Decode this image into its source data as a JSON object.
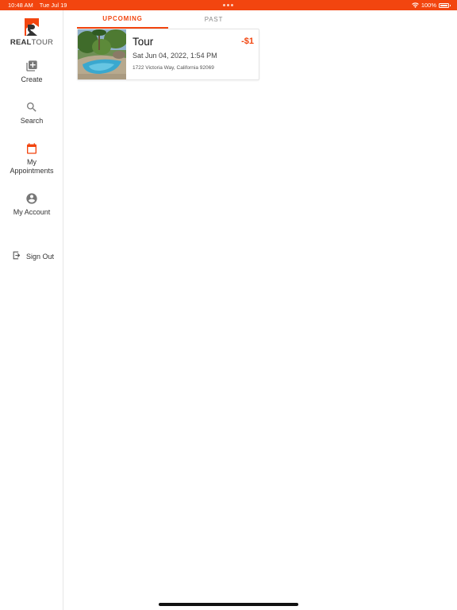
{
  "status_bar": {
    "time": "10:48 AM",
    "date": "Tue Jul 19",
    "battery": "100%",
    "icons": [
      "wifi-icon",
      "battery-icon"
    ]
  },
  "brand": {
    "name_bold": "REAL",
    "name_light": "TOUR",
    "accent_color": "#f2450f"
  },
  "sidebar": {
    "items": [
      {
        "label": "Create",
        "icon": "add-box-icon"
      },
      {
        "label": "Search",
        "icon": "search-icon"
      },
      {
        "label": "My Appointments",
        "icon": "calendar-icon",
        "active": true
      },
      {
        "label": "My Account",
        "icon": "account-circle-icon"
      }
    ],
    "sign_out": {
      "label": "Sign Out",
      "icon": "sign-out-icon"
    }
  },
  "tabs": [
    {
      "label": "UPCOMING",
      "active": true
    },
    {
      "label": "PAST",
      "active": false
    }
  ],
  "appointments": [
    {
      "title": "Tour",
      "date": "Sat Jun 04, 2022, 1:54 PM",
      "address": "1722 Victoria Way, California 92069",
      "price": "-$1"
    }
  ]
}
